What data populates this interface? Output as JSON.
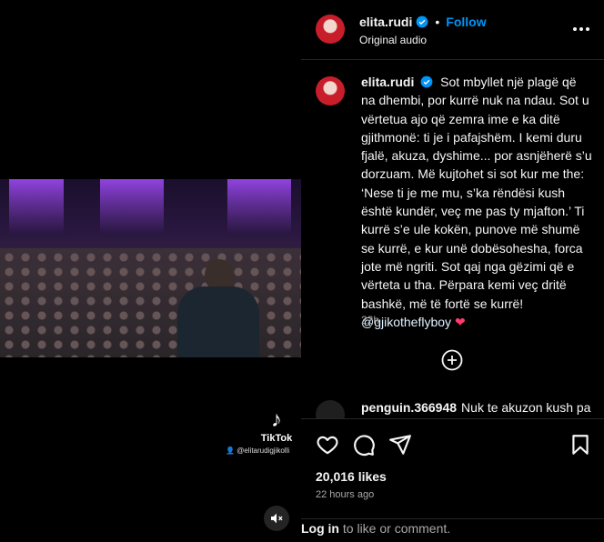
{
  "post": {
    "username": "elita.rudi",
    "follow_label": "Follow",
    "separator": "•",
    "audio_label": "Original audio",
    "caption": "Sot mbyllet një plagë që na dhembi, por kurrë nuk na ndau. Sot u vërtetua ajo që zemra ime e ka ditë gjithmonë: ti je i pafajshëm. I kemi duru fjalë, akuza, dyshime... por asnjëherë s’u dorzuam. Më kujtohet si sot kur me the: ‘Nese ti je me mu, s’ka rëndësi kush është kundër, veç me pas ty mjafton.’ Ti kurrë s’e ule kokën, punove më shumë se kurrë, e kur unë dobësohesha, forca jote më ngriti. Sot qaj nga gëzimi që e vërteta u tha. Përpara kemi veç dritë bashkë, më të fortë se kurrë!",
    "mention": "@gjikotheflyboy",
    "heart": "❤",
    "caption_age": "22h"
  },
  "comment": {
    "username": "penguin.366948",
    "text": "Nuk te akuzon kush pa"
  },
  "actions": {
    "like_icon": "heart-outline-icon",
    "comment_icon": "comment-bubble-icon",
    "share_icon": "paper-plane-icon",
    "save_icon": "bookmark-icon"
  },
  "likes": "20,016 likes",
  "posted": "22 hours ago",
  "login": {
    "link": "Log in",
    "rest": " to like or comment."
  },
  "video": {
    "watermark_label": "TikTok",
    "watermark_handle": "@elitarudigjikolli",
    "mute_icon": "speaker-muted-icon"
  },
  "colors": {
    "background": "#000000",
    "link_blue": "#0095f6",
    "verified_blue": "#0095f6",
    "heart_pink": "#ff3b6b"
  }
}
